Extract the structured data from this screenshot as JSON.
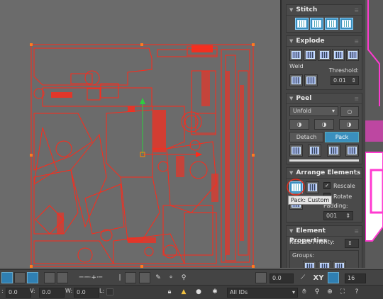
{
  "stitch": {
    "title": "Stitch"
  },
  "explode": {
    "title": "Explode",
    "weld_label": "Weld",
    "threshold_label": "Threshold:",
    "threshold_value": "0.01"
  },
  "peel": {
    "title": "Peel",
    "mode_value": "Unfold",
    "detach_label": "Detach",
    "pack_label": "Pack"
  },
  "arrange": {
    "title": "Arrange Elements",
    "rescale_label": "Rescale",
    "rotate_label": "Rotate",
    "padding_label": "Padding:",
    "padding_value": "001",
    "rescale_checked": "✓",
    "tooltip": "Pack: Custom"
  },
  "element_props": {
    "title": "Element Properties",
    "rescale_priority_label": "Rescale Priority:",
    "groups_label": "Groups:"
  },
  "bottom_toolbar": {
    "spin_value": "0.0",
    "xy_label": "XY",
    "snap_value": "16"
  },
  "status_bar": {
    "u_label": ":",
    "u_value": "0.0",
    "v_label": "V:",
    "v_value": "0.0",
    "w_label": "W:",
    "w_value": "0.0",
    "l_label": "L:",
    "ids_value": "All IDs"
  },
  "colors": {
    "accent": "#3a8fbd",
    "uv_lines": "#ff2a1a",
    "viewport_bg": "#6b6b6b",
    "panel_bg": "#444444",
    "gizmo_green": "#2ecc40",
    "selection_circle": "#e03020"
  }
}
